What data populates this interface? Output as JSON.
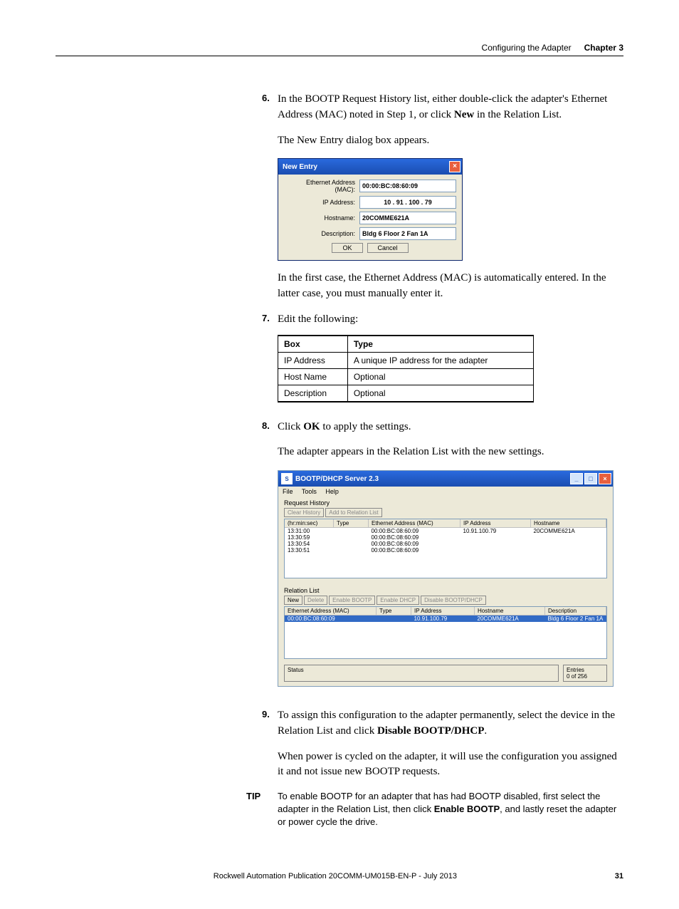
{
  "header": {
    "breadcrumb": "Configuring the Adapter",
    "chapter_label": "Chapter 3"
  },
  "step6": {
    "num": "6.",
    "prefix": "In the BOOTP Request History list, either double-click the adapter's Ethernet Address (MAC) noted in Step 1, or click ",
    "bold": "New",
    "suffix": " in the Relation List.",
    "after": "The New Entry dialog box appears."
  },
  "new_entry_dialog": {
    "title": "New Entry",
    "rows": {
      "mac_label": "Ethernet Address (MAC):",
      "mac_value": "00:00:BC:08:60:09",
      "ip_label": "IP Address:",
      "ip_value": "10  .  91  . 100  .  79",
      "host_label": "Hostname:",
      "host_value": "20COMME621A",
      "desc_label": "Description:",
      "desc_value": "Bldg 6 Floor 2 Fan 1A"
    },
    "ok": "OK",
    "cancel": "Cancel"
  },
  "step6_followup": "In the first case, the Ethernet Address (MAC) is automatically entered. In the latter case, you must manually enter it.",
  "step7": {
    "num": "7.",
    "text": "Edit the following:"
  },
  "edit_table": {
    "headers": [
      "Box",
      "Type"
    ],
    "rows": [
      [
        "IP Address",
        "A unique IP address for the adapter"
      ],
      [
        "Host Name",
        "Optional"
      ],
      [
        "Description",
        "Optional"
      ]
    ]
  },
  "step8": {
    "num": "8.",
    "prefix": "Click ",
    "bold": "OK",
    "suffix": " to apply the settings.",
    "after": "The adapter appears in the Relation List with the new settings."
  },
  "bootp_window": {
    "title": "BOOTP/DHCP Server 2.3",
    "menu": [
      "File",
      "Tools",
      "Help"
    ],
    "req_history": {
      "label": "Request History",
      "btn_clear": "Clear History",
      "btn_add": "Add to Relation List",
      "cols": [
        "(hr:min:sec)",
        "Type",
        "Ethernet Address (MAC)",
        "IP Address",
        "Hostname"
      ],
      "rows": [
        [
          "13:31:00",
          "",
          "00:00:BC:08:60:09",
          "10.91.100.79",
          "20COMME621A"
        ],
        [
          "13:30:59",
          "",
          "00:00:BC:08:60:09",
          "",
          ""
        ],
        [
          "13:30:54",
          "",
          "00:00:BC:08:60:09",
          "",
          ""
        ],
        [
          "13:30:51",
          "",
          "00:00:BC:08:60:09",
          "",
          ""
        ]
      ]
    },
    "relation_list": {
      "label": "Relation List",
      "btn_new": "New",
      "btn_delete": "Delete",
      "btn_enable_bootp": "Enable BOOTP",
      "btn_enable_dhcp": "Enable DHCP",
      "btn_disable": "Disable BOOTP/DHCP",
      "cols": [
        "Ethernet Address (MAC)",
        "Type",
        "IP Address",
        "Hostname",
        "Description"
      ],
      "rows": [
        [
          "00:00:BC:08:60:09",
          "",
          "10.91.100.79",
          "20COMME621A",
          "Bldg 6 Floor 2 Fan 1A"
        ]
      ]
    },
    "status_label": "Status",
    "entries_label": "Entries",
    "entries_value": "0 of 256"
  },
  "step9": {
    "num": "9.",
    "prefix": "To assign this configuration to the adapter permanently, select the device in the Relation List and click ",
    "bold": "Disable BOOTP/DHCP",
    "suffix": ".",
    "after": "When power is cycled on the adapter, it will use the configuration you assigned it and not issue new BOOTP requests."
  },
  "tip": {
    "label": "TIP",
    "prefix": "To enable BOOTP for an adapter that has had BOOTP disabled, first select the adapter in the Relation List, then click ",
    "bold": "Enable BOOTP",
    "suffix": ", and lastly reset the adapter or power cycle the drive."
  },
  "footer": {
    "pub": "Rockwell Automation Publication  20COMM-UM015B-EN-P - July 2013",
    "page": "31"
  }
}
